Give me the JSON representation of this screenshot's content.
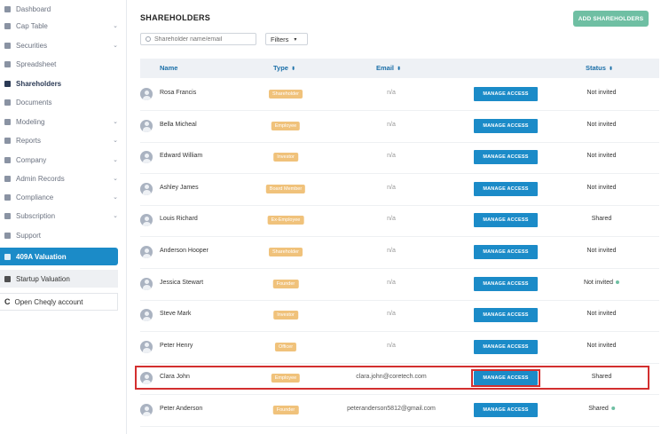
{
  "sidebar": {
    "items": [
      {
        "label": "Dashboard",
        "chevron": false
      },
      {
        "label": "Cap Table",
        "chevron": true
      },
      {
        "label": "Securities",
        "chevron": true
      },
      {
        "label": "Spreadsheet",
        "chevron": false
      },
      {
        "label": "Shareholders",
        "chevron": false,
        "active": true
      },
      {
        "label": "Documents",
        "chevron": false
      },
      {
        "label": "Modeling",
        "chevron": true
      },
      {
        "label": "Reports",
        "chevron": true
      },
      {
        "label": "Company",
        "chevron": true
      },
      {
        "label": "Admin Records",
        "chevron": true
      },
      {
        "label": "Compliance",
        "chevron": true
      },
      {
        "label": "Subscription",
        "chevron": true
      },
      {
        "label": "Support",
        "chevron": false
      }
    ],
    "valuation_409a": "409A Valuation",
    "startup_valuation": "Startup Valuation",
    "open_account": "Open Cheqly account",
    "chevron_glyph": "⌄"
  },
  "main": {
    "title": "SHAREHOLDERS",
    "add_button": "ADD SHAREHOLDERS",
    "search_placeholder": "Shareholder name/email",
    "filters_label": "Filters",
    "filters_caret": "▾",
    "columns": {
      "name": "Name",
      "type": "Type",
      "email": "Email",
      "status": "Status"
    },
    "sort_glyph": "⬍",
    "manage_label": "MANAGE ACCESS"
  },
  "rows": [
    {
      "name": "Rosa Francis",
      "type": "Shareholder",
      "email": "n/a",
      "status": "Not invited",
      "dot": false
    },
    {
      "name": "Bella Micheal",
      "type": "Employee",
      "email": "n/a",
      "status": "Not invited",
      "dot": false
    },
    {
      "name": "Edward William",
      "type": "Investor",
      "email": "n/a",
      "status": "Not invited",
      "dot": false
    },
    {
      "name": "Ashley James",
      "type": "Board Member",
      "email": "n/a",
      "status": "Not invited",
      "dot": false
    },
    {
      "name": "Louis Richard",
      "type": "Ex-Employee",
      "email": "n/a",
      "status": "Shared",
      "dot": false
    },
    {
      "name": "Anderson Hooper",
      "type": "Shareholder",
      "email": "n/a",
      "status": "Not invited",
      "dot": false
    },
    {
      "name": "Jessica Stewart",
      "type": "Founder",
      "email": "n/a",
      "status": "Not invited",
      "dot": true
    },
    {
      "name": "Steve Mark",
      "type": "Investor",
      "email": "n/a",
      "status": "Not invited",
      "dot": false
    },
    {
      "name": "Peter Henry",
      "type": "Officer",
      "email": "n/a",
      "status": "Not invited",
      "dot": false
    },
    {
      "name": "Clara John",
      "type": "Employee",
      "email": "clara.john@coretech.com",
      "status": "Shared",
      "dot": false
    },
    {
      "name": "Peter Anderson",
      "type": "Founder",
      "email": "peteranderson5812@gmail.com",
      "status": "Shared",
      "dot": true
    }
  ],
  "colors": {
    "accent": "#1b8bc8",
    "add_button": "#6fbfa3",
    "type_badge": "#f0c27b",
    "highlight": "#d32f2f"
  }
}
